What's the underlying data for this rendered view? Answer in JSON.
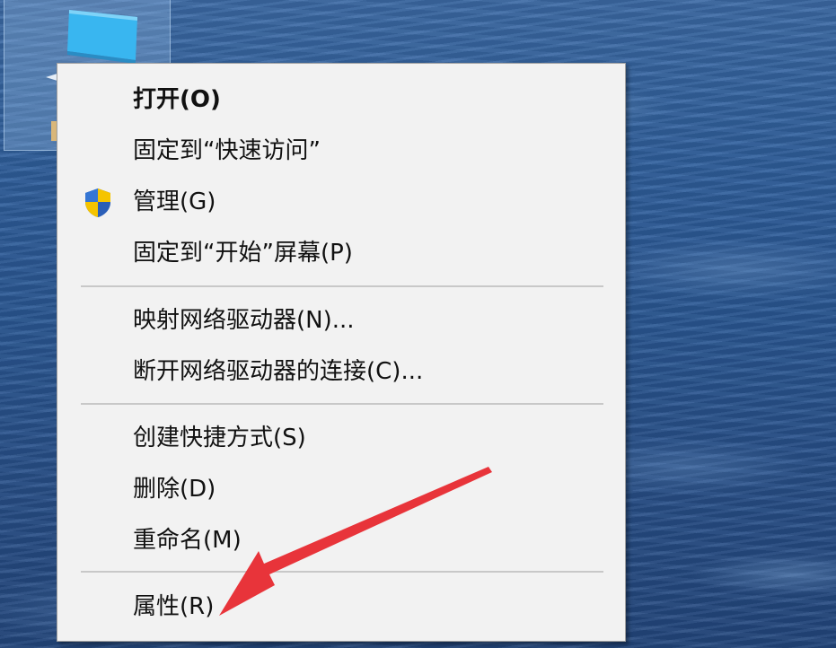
{
  "context_menu": {
    "items": [
      {
        "label": "打开(O)",
        "bold": true,
        "icon": ""
      },
      {
        "label": "固定到“快速访问”",
        "bold": false,
        "icon": ""
      },
      {
        "label": "管理(G)",
        "bold": false,
        "icon": "uac-shield-icon"
      },
      {
        "label": "固定到“开始”屏幕(P)",
        "bold": false,
        "icon": ""
      },
      {
        "label": "映射网络驱动器(N)...",
        "bold": false,
        "icon": ""
      },
      {
        "label": "断开网络驱动器的连接(C)...",
        "bold": false,
        "icon": ""
      },
      {
        "label": "创建快捷方式(S)",
        "bold": false,
        "icon": ""
      },
      {
        "label": "删除(D)",
        "bold": false,
        "icon": ""
      },
      {
        "label": "重命名(M)",
        "bold": false,
        "icon": ""
      },
      {
        "label": "属性(R)",
        "bold": false,
        "icon": ""
      }
    ]
  },
  "annotation": {
    "color": "#e8343a",
    "points_to": "属性(R)"
  },
  "colors": {
    "menu_background": "#f2f2f2",
    "menu_border": "#a0a0a0",
    "separator": "#c8c8c8",
    "text": "#111111"
  }
}
